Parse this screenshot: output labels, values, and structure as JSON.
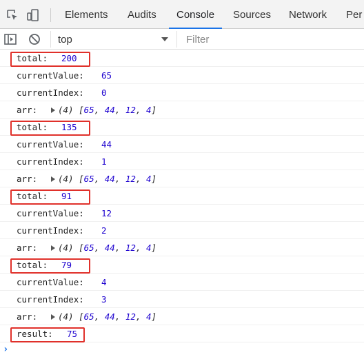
{
  "tabs": [
    "Elements",
    "Audits",
    "Console",
    "Sources",
    "Network",
    "Per"
  ],
  "active_tab": "Console",
  "toolbar": {
    "context": "top",
    "filter_placeholder": "Filter"
  },
  "logs": [
    {
      "label": "total:",
      "value": "200",
      "highlight": true
    },
    {
      "label": "currentValue:",
      "value": "65"
    },
    {
      "label": "currentIndex:",
      "value": "0"
    },
    {
      "label": "arr:",
      "array": true,
      "len": "(4)",
      "items": [
        "65",
        "44",
        "12",
        "4"
      ]
    },
    {
      "label": "total:",
      "value": "135",
      "highlight": true
    },
    {
      "label": "currentValue:",
      "value": "44"
    },
    {
      "label": "currentIndex:",
      "value": "1"
    },
    {
      "label": "arr:",
      "array": true,
      "len": "(4)",
      "items": [
        "65",
        "44",
        "12",
        "4"
      ]
    },
    {
      "label": "total:",
      "value": "91",
      "highlight": true
    },
    {
      "label": "currentValue:",
      "value": "12"
    },
    {
      "label": "currentIndex:",
      "value": "2"
    },
    {
      "label": "arr:",
      "array": true,
      "len": "(4)",
      "items": [
        "65",
        "44",
        "12",
        "4"
      ]
    },
    {
      "label": "total:",
      "value": "79",
      "highlight": true
    },
    {
      "label": "currentValue:",
      "value": "4"
    },
    {
      "label": "currentIndex:",
      "value": "3"
    },
    {
      "label": "arr:",
      "array": true,
      "len": "(4)",
      "items": [
        "65",
        "44",
        "12",
        "4"
      ]
    },
    {
      "label": "result:",
      "value": "75",
      "highlight": true
    }
  ],
  "prompt": "›",
  "colors": {
    "highlight_border": "#e0302a",
    "number": "#1c00cf",
    "active_tab_underline": "#1a73e8"
  }
}
